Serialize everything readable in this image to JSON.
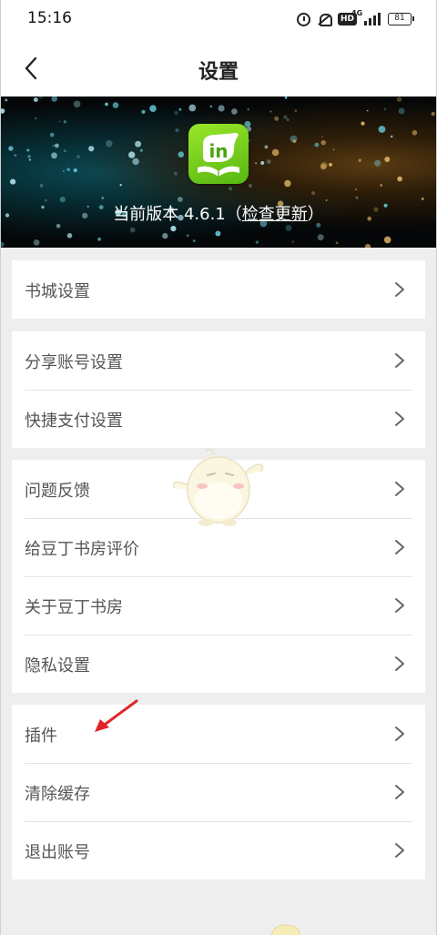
{
  "status_bar": {
    "time": "15:16",
    "hd": "HD",
    "network": "4G",
    "battery": "81"
  },
  "header": {
    "title": "设置",
    "back_icon": "chevron-left-icon"
  },
  "banner": {
    "version_prefix": "当前版本 4.6.1（",
    "check_update": "检查更新",
    "version_suffix": "）",
    "logo_text": "in"
  },
  "groups": [
    {
      "items": [
        {
          "label": "书城设置"
        }
      ]
    },
    {
      "items": [
        {
          "label": "分享账号设置"
        },
        {
          "label": "快捷支付设置"
        }
      ]
    },
    {
      "items": [
        {
          "label": "问题反馈"
        },
        {
          "label": "给豆丁书房评价"
        },
        {
          "label": "关于豆丁书房"
        },
        {
          "label": "隐私设置"
        }
      ]
    },
    {
      "items": [
        {
          "label": "插件"
        },
        {
          "label": "清除缓存"
        },
        {
          "label": "退出账号"
        }
      ]
    }
  ],
  "colors": {
    "background": "#eeeeee",
    "annotation_arrow": "#e0262b",
    "logo_green": "#6cc81a"
  }
}
